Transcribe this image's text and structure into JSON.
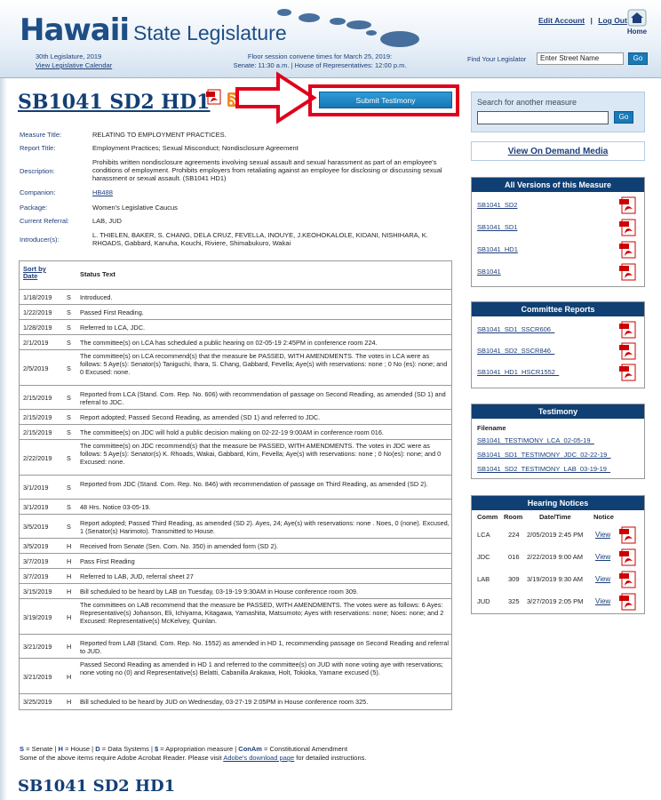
{
  "header": {
    "logo_word": "Hawaii",
    "logo_rest": "State Legislature",
    "edit_account": "Edit Account",
    "separator": "|",
    "log_out": "Log Out",
    "home": "Home",
    "legislature": "30th Legislature, 2019",
    "calendar_link": "View Legislative Calendar",
    "floor_line1": "Floor session convene times for March 25, 2019:",
    "floor_line2": "Senate: 11:30 a.m. | House of Representatives: 12:00 p.m.",
    "find_legislator": "Find Your Legislator",
    "street_placeholder": "Enter Street Name",
    "go": "Go"
  },
  "measure": {
    "title": "SB1041 SD2 HD1",
    "submit_testimony": "Submit Testimony",
    "fields": [
      {
        "label": "Measure Title:",
        "value": "RELATING TO EMPLOYMENT PRACTICES."
      },
      {
        "label": "Report Title:",
        "value": "Employment Practices; Sexual Misconduct; Nondisclosure Agreement"
      },
      {
        "label": "Description:",
        "value": "Prohibits written nondisclosure agreements involving sexual assault and sexual harassment as part of an employee's conditions of employment. Prohibits employers from retaliating against an employee for disclosing or discussing sexual harassment or sexual assault. (SB1041 HD1)"
      },
      {
        "label": "Companion:",
        "value": "HB488"
      },
      {
        "label": "Package:",
        "value": "Women's Legislative Caucus"
      },
      {
        "label": "Current Referral:",
        "value": "LAB, JUD"
      },
      {
        "label": "Introducer(s):",
        "value": "L. THIELEN, BAKER, S. CHANG, DELA CRUZ, FEVELLA, INOUYE, J.KEOHOKALOLE, KIDANI, NISHIHARA, K. RHOADS, Gabbard, Kanuha, Kouchi, Riviere, Shimabukuro, Wakai"
      }
    ]
  },
  "status_table": {
    "sort_by": "Sort by",
    "date": "Date",
    "status_header": "Status Text",
    "rows": [
      {
        "date": "1/18/2019",
        "chamber": "S",
        "text": "Introduced."
      },
      {
        "date": "1/22/2019",
        "chamber": "S",
        "text": "Passed First Reading."
      },
      {
        "date": "1/28/2019",
        "chamber": "S",
        "text": "Referred to LCA, JDC."
      },
      {
        "date": "2/1/2019",
        "chamber": "S",
        "text": "The committee(s) on LCA has scheduled a public hearing on 02-05-19 2:45PM in conference room 224."
      },
      {
        "date": "2/5/2019",
        "chamber": "S",
        "text": "The committee(s) on LCA recommend(s) that the measure be PASSED, WITH AMENDMENTS. The votes in LCA were as follows: 5 Aye(s): Senator(s) Taniguchi, Ihara, S. Chang, Gabbard, Fevella; Aye(s) with reservations: none ; 0 No (es): none; and 0 Excused: none."
      },
      {
        "date": "2/15/2019",
        "chamber": "S",
        "text": "Reported from LCA (Stand. Com. Rep. No. 606) with recommendation of passage on Second Reading, as amended (SD 1) and referral to JDC."
      },
      {
        "date": "2/15/2019",
        "chamber": "S",
        "text": "Report adopted; Passed Second Reading, as amended (SD 1) and referred to JDC."
      },
      {
        "date": "2/15/2019",
        "chamber": "S",
        "text": "The committee(s) on JDC will hold a public decision making on 02-22-19 9:00AM in conference room 016."
      },
      {
        "date": "2/22/2019",
        "chamber": "S",
        "text": "The committee(s) on JDC recommend(s) that the measure be PASSED, WITH AMENDMENTS. The votes in JDC were as follows: 5 Aye(s): Senator(s) K. Rhoads, Wakai, Gabbard, Kim, Fevella; Aye(s) with reservations: none ; 0 No(es): none; and 0 Excused: none."
      },
      {
        "date": "3/1/2019",
        "chamber": "S",
        "text": "Reported from JDC (Stand. Com. Rep. No. 846) with recommendation of passage on Third Reading, as amended (SD 2)."
      },
      {
        "date": "3/1/2019",
        "chamber": "S",
        "text": "48 Hrs. Notice 03-05-19."
      },
      {
        "date": "3/5/2019",
        "chamber": "S",
        "text": "Report adopted; Passed Third Reading, as amended (SD 2). Ayes, 24; Aye(s) with reservations: none . Noes, 0 (none). Excused, 1 (Senator(s) Harimoto). Transmitted to House."
      },
      {
        "date": "3/5/2019",
        "chamber": "H",
        "text": "Received from Senate (Sen. Com. No. 350) in amended form (SD 2)."
      },
      {
        "date": "3/7/2019",
        "chamber": "H",
        "text": "Pass First Reading"
      },
      {
        "date": "3/7/2019",
        "chamber": "H",
        "text": "Referred to LAB, JUD, referral sheet 27"
      },
      {
        "date": "3/15/2019",
        "chamber": "H",
        "text": "Bill scheduled to be heard by LAB on Tuesday, 03-19-19 9:30AM in House conference room 309."
      },
      {
        "date": "3/19/2019",
        "chamber": "H",
        "text": "The committees on LAB recommend that the measure be PASSED, WITH AMENDMENTS. The votes were as follows: 6 Ayes: Representative(s) Johanson, Eli, Ichiyama, Kitagawa, Yamashita, Matsumoto; Ayes with reservations: none; Noes: none; and 2 Excused: Representative(s) McKelvey, Quinlan."
      },
      {
        "date": "3/21/2019",
        "chamber": "H",
        "text": "Reported from LAB (Stand. Com. Rep. No. 1552) as amended in HD 1, recommending passage on Second Reading and referral to JUD."
      },
      {
        "date": "3/21/2019",
        "chamber": "H",
        "text": "Passed Second Reading as amended in HD 1 and referred to the committee(s) on JUD with none voting aye with reservations; none voting no (0) and Representative(s) Belatti, Cabanilla Arakawa, Holt, Tokioka, Yamane excused (5)."
      },
      {
        "date": "3/25/2019",
        "chamber": "H",
        "text": "Bill scheduled to be heard by JUD on Wednesday, 03-27-19 2:05PM in House conference room 325."
      }
    ]
  },
  "legend": {
    "line1_parts": [
      "S",
      " = Senate | ",
      "H",
      " = House | ",
      "D",
      " = Data Systems | ",
      "$",
      " = Appropriation measure | ",
      "ConAm",
      " = Constitutional Amendment"
    ],
    "line2_a": "Some of the above items require Adobe Acrobat Reader. Please visit ",
    "line2_link": "Adobe's download page",
    "line2_b": " for detailed instructions."
  },
  "sidebar": {
    "search_label": "Search for another measure",
    "go": "Go",
    "vod": "View On Demand Media",
    "versions_title": "All Versions of this Measure",
    "versions": [
      "SB1041_SD2",
      "SB1041_SD1",
      "SB1041_HD1",
      "SB1041"
    ],
    "committee_title": "Committee Reports",
    "committee_reports": [
      "SB1041_SD1_SSCR606_",
      "SB1041_SD2_SSCR846_",
      "SB1041_HD1_HSCR1552_"
    ],
    "testimony_title": "Testimony",
    "filename_label": "Filename",
    "testimony": [
      "SB1041_TESTIMONY_LCA_02-05-19_",
      "SB1041_SD1_TESTIMONY_JDC_02-22-19_",
      "SB1041_SD2_TESTIMONY_LAB_03-19-19_"
    ],
    "hearing_title": "Hearing Notices",
    "hearing_headers": {
      "comm": "Comm",
      "room": "Room",
      "datetime": "Date/Time",
      "notice": "Notice"
    },
    "hearings": [
      {
        "comm": "LCA",
        "room": "224",
        "datetime": "2/05/2019 2:45 PM",
        "view": "View"
      },
      {
        "comm": "JDC",
        "room": "016",
        "datetime": "2/22/2019 9:00 AM",
        "view": "View"
      },
      {
        "comm": "LAB",
        "room": "309",
        "datetime": "3/19/2019 9:30 AM",
        "view": "View"
      },
      {
        "comm": "JUD",
        "room": "325",
        "datetime": "3/27/2019 2:05 PM",
        "view": "View"
      }
    ]
  },
  "colors": {
    "brand_blue": "#1d4e86",
    "panel_header": "#0f3f73",
    "annotation_red": "#e0001b",
    "button_blue": "#1a7ab8"
  }
}
